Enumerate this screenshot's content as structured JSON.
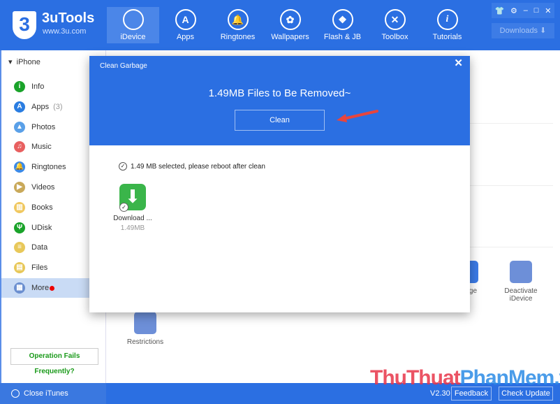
{
  "app": {
    "logo_mark": "3",
    "name": "3uTools",
    "url": "www.3u.com"
  },
  "nav": [
    {
      "label": "iDevice",
      "icon": "apple-icon",
      "glyph": "",
      "active": true
    },
    {
      "label": "Apps",
      "icon": "app-store-icon",
      "glyph": "A"
    },
    {
      "label": "Ringtones",
      "icon": "bell-icon",
      "glyph": "🔔"
    },
    {
      "label": "Wallpapers",
      "icon": "flower-icon",
      "glyph": "✿"
    },
    {
      "label": "Flash & JB",
      "icon": "dropbox-icon",
      "glyph": "❖"
    },
    {
      "label": "Toolbox",
      "icon": "tools-icon",
      "glyph": "✕"
    },
    {
      "label": "Tutorials",
      "icon": "info-icon",
      "glyph": "i"
    }
  ],
  "window_controls": [
    "👕",
    "⚙",
    "–",
    "□",
    "✕"
  ],
  "downloads": {
    "label": "Downloads",
    "icon": "⬇"
  },
  "sidebar": {
    "device": "iPhone",
    "items": [
      {
        "label": "Info",
        "color": "#1aa32a",
        "glyph": "i"
      },
      {
        "label": "Apps",
        "count": "(3)",
        "color": "#2a7de1",
        "glyph": "A"
      },
      {
        "label": "Photos",
        "color": "#5aa0e8",
        "glyph": "▲"
      },
      {
        "label": "Music",
        "color": "#e86060",
        "glyph": "♫"
      },
      {
        "label": "Ringtones",
        "color": "#3b8ae8",
        "glyph": "🔔"
      },
      {
        "label": "Videos",
        "color": "#c9a95a",
        "glyph": "▶"
      },
      {
        "label": "Books",
        "color": "#f0c860",
        "glyph": "▥"
      },
      {
        "label": "UDisk",
        "color": "#1aa32a",
        "glyph": "Ψ"
      },
      {
        "label": "Data",
        "color": "#e8c85a",
        "glyph": "≡"
      },
      {
        "label": "Files",
        "color": "#e8c85a",
        "glyph": "▤"
      },
      {
        "label": "More",
        "color": "#6b8fd0",
        "glyph": "▦",
        "selected": true,
        "badge": true
      }
    ],
    "help": "Operation Fails Frequently?"
  },
  "background": {
    "tools": [
      {
        "label": "Clean Garbage",
        "visible_text": "arbage"
      },
      {
        "label": "Deactivate iDevice"
      },
      {
        "label": "Restrictions"
      }
    ]
  },
  "modal": {
    "title": "Clean Garbage",
    "close": "✕",
    "headline": "1.49MB Files to Be Removed~",
    "clean_button": "Clean",
    "selected_text": "1.49 MB selected, please reboot after clean",
    "items": [
      {
        "name": "Download ...",
        "size": "1.49MB"
      }
    ]
  },
  "footer": {
    "close_itunes": "Close iTunes",
    "version": "V2.30",
    "feedback": "Feedback",
    "check_update": "Check Update"
  },
  "watermark": {
    "part1": "ThuThuat",
    "part2": "PhanMem.vn"
  }
}
